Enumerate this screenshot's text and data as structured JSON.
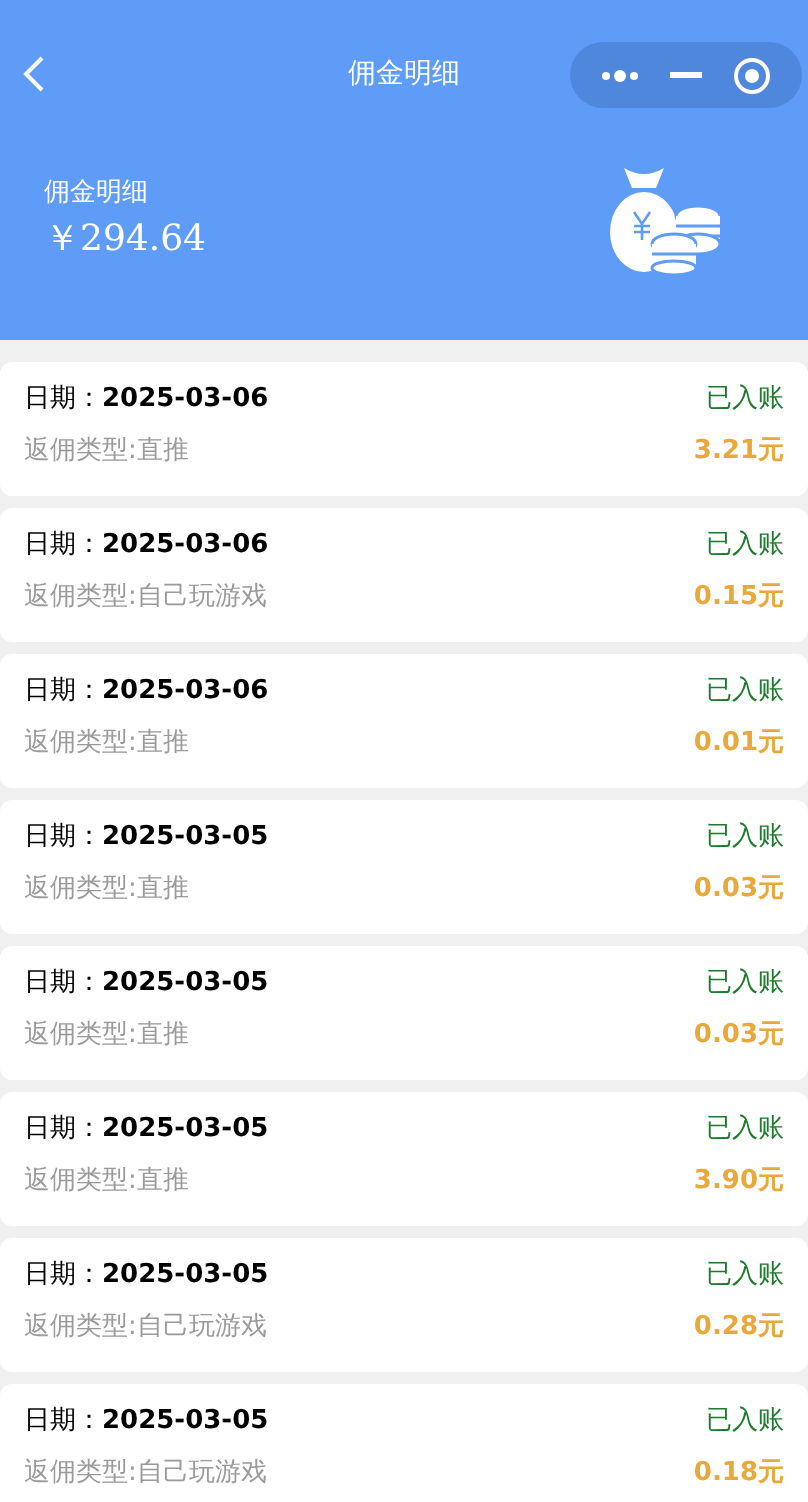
{
  "nav": {
    "title": "佣金明细"
  },
  "summary": {
    "label": "佣金明细",
    "amount": "￥294.64"
  },
  "records": [
    {
      "date": "日期：**2025-03-06**",
      "status": "已入账",
      "type": "返佣类型:直推",
      "amount": "3.21元"
    },
    {
      "date": "日期：**2025-03-06**",
      "status": "已入账",
      "type": "返佣类型:自己玩游戏",
      "amount": "0.15元"
    },
    {
      "date": "日期：**2025-03-06**",
      "status": "已入账",
      "type": "返佣类型:直推",
      "amount": "0.01元"
    },
    {
      "date": "日期：**2025-03-05**",
      "status": "已入账",
      "type": "返佣类型:直推",
      "amount": "0.03元"
    },
    {
      "date": "日期：**2025-03-05**",
      "status": "已入账",
      "type": "返佣类型:直推",
      "amount": "0.03元"
    },
    {
      "date": "日期：**2025-03-05**",
      "status": "已入账",
      "type": "返佣类型:直推",
      "amount": "3.90元"
    },
    {
      "date": "日期：**2025-03-05**",
      "status": "已入账",
      "type": "返佣类型:自己玩游戏",
      "amount": "0.28元"
    },
    {
      "date": "日期：**2025-03-05**",
      "status": "已入账",
      "type": "返佣类型:自己玩游戏",
      "amount": "0.18元"
    }
  ]
}
